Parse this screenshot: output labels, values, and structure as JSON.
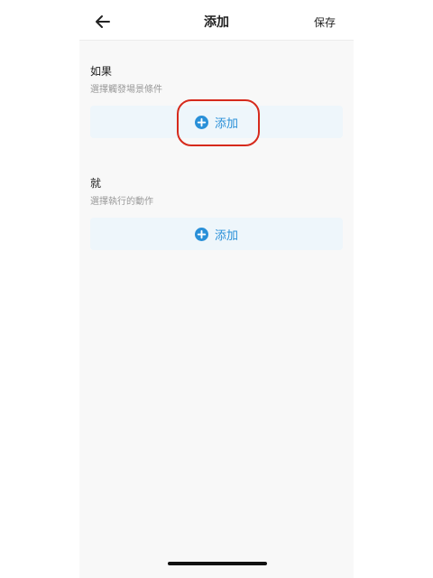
{
  "header": {
    "title": "添加",
    "save_label": "保存",
    "back_icon": "arrow-left-icon"
  },
  "if_section": {
    "title": "如果",
    "subtitle": "選擇觸發場景條件",
    "add_label": "添加",
    "add_icon": "plus-circle-icon"
  },
  "then_section": {
    "title": "就",
    "subtitle": "選擇執行的動作",
    "add_label": "添加",
    "add_icon": "plus-circle-icon"
  },
  "colors": {
    "accent": "#2a90d8",
    "card_bg": "#eef6fb",
    "annotation": "#d62a1c"
  }
}
